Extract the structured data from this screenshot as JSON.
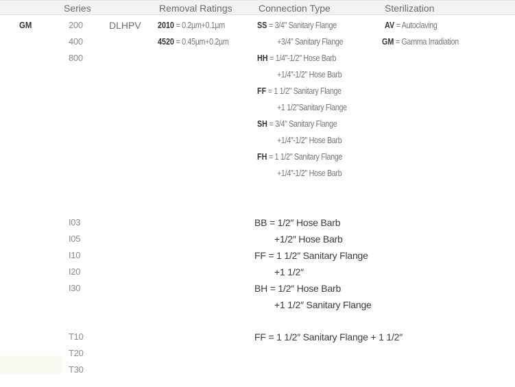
{
  "header": {
    "series": "Series",
    "removal_ratings": "Removal Ratings",
    "connection_type": "Connection Type",
    "sterilization": "Sterilization"
  },
  "group1": {
    "code": "GM",
    "series": [
      "200",
      "400",
      "800"
    ],
    "model": "DLHPV",
    "removal_ratings": [
      {
        "code": "2010",
        "text": "= 0.2µm+0.1µm"
      },
      {
        "code": "4520",
        "text": "= 0.45µm+0.2µm"
      }
    ],
    "connections": [
      {
        "code": "SS",
        "line1": "=  3/4\" Sanitary Flange",
        "line2": "+3/4\" Sanitary Flange"
      },
      {
        "code": "HH",
        "line1": "=  1/4\"-1/2\" Hose Barb",
        "line2": "+1/4\"-1/2\" Hose Barb"
      },
      {
        "code": "FF",
        "line1": "=  1 1/2\" Sanitary Flange",
        "line2": "+1 1/2\"Sanitary Flange"
      },
      {
        "code": "SH",
        "line1": "=  3/4\" Sanitary Flange",
        "line2": "+1/4\"-1/2\" Hose Barb"
      },
      {
        "code": "FH",
        "line1": "=  1 1/2\" Sanitary Flange",
        "line2": "+1/4\"-1/2\" Hose Barb"
      }
    ],
    "sterilization": [
      {
        "code": "AV",
        "text": "= Autoclaving"
      },
      {
        "code": "GM",
        "text": "= Gamma Irradiation"
      }
    ]
  },
  "group2": {
    "series": [
      "I03",
      "I05",
      "I10",
      "I20",
      "I30"
    ],
    "connections": [
      {
        "code": "BB",
        "line1": "=  1/2″ Hose Barb",
        "line2": "+1/2″ Hose Barb"
      },
      {
        "code": "FF",
        "line1": "=  1 1/2″ Sanitary Flange",
        "line2": "+1 1/2″"
      },
      {
        "code": "BH",
        "line1": "=  1/2″ Hose Barb",
        "line2": "+1 1/2″ Sanitary Flange"
      }
    ]
  },
  "group3": {
    "series": [
      "T10",
      "T20",
      "T30"
    ],
    "connections": [
      {
        "code": "FF",
        "line1": "=  1 1/2″ Sanitary Flange + 1 1/2″"
      }
    ]
  }
}
